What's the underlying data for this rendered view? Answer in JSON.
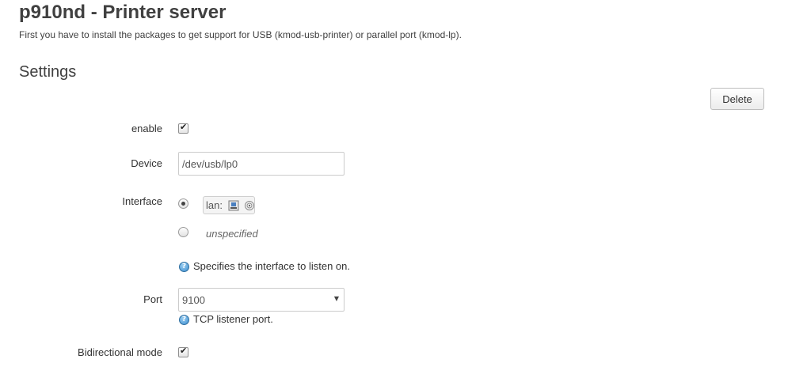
{
  "page": {
    "title": "p910nd - Printer server",
    "description": "First you have to install the packages to get support for USB (kmod-usb-printer) or parallel port (kmod-lp)."
  },
  "section": {
    "title": "Settings",
    "delete_label": "Delete"
  },
  "fields": {
    "enable": {
      "label": "enable",
      "checked": true
    },
    "device": {
      "label": "Device",
      "value": "/dev/usb/lp0"
    },
    "interface": {
      "label": "Interface",
      "options": [
        {
          "label": "lan:",
          "selected": true,
          "icons": [
            "network-port-icon",
            "wifi-icon"
          ]
        },
        {
          "label": "unspecified",
          "selected": false
        }
      ],
      "help": "Specifies the interface to listen on."
    },
    "port": {
      "label": "Port",
      "value": "9100",
      "help": "TCP listener port."
    },
    "bidirectional": {
      "label": "Bidirectional mode",
      "checked": true
    }
  },
  "icons": {
    "help": "help-icon",
    "checkmark": "checkmark-icon",
    "dropdown": "chevron-down-icon"
  },
  "colors": {
    "text": "#333333",
    "heading": "#404040",
    "help_icon": "#3b8ccf"
  }
}
